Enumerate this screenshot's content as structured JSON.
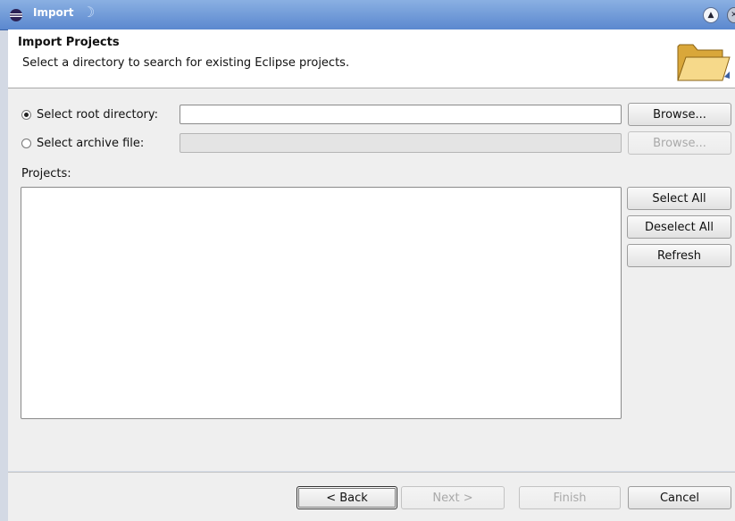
{
  "window": {
    "title": "Import"
  },
  "header": {
    "title": "Import Projects",
    "description": "Select a directory to search for existing Eclipse projects."
  },
  "source": {
    "root_label": "Select root directory:",
    "root_value": "",
    "root_selected": true,
    "archive_label": "Select archive file:",
    "archive_value": "",
    "archive_selected": false,
    "browse_label": "Browse..."
  },
  "projects": {
    "label": "Projects:",
    "items": [],
    "select_all": "Select All",
    "deselect_all": "Deselect All",
    "refresh": "Refresh"
  },
  "footer": {
    "back": "< Back",
    "next": "Next >",
    "finish": "Finish",
    "cancel": "Cancel"
  },
  "icons": {
    "app": "eclipse-icon",
    "header": "folder-open-icon"
  }
}
